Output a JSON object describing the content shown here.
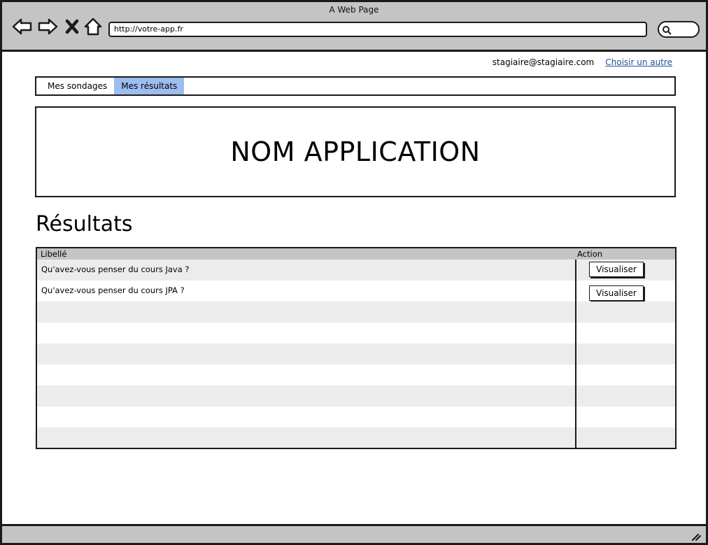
{
  "browser": {
    "window_title": "A Web Page",
    "url": "http://votre-app.fr"
  },
  "user": {
    "email": "stagiaire@stagiaire.com",
    "switch_link": "Choisir un autre"
  },
  "tabs": [
    {
      "label": "Mes sondages",
      "active": false
    },
    {
      "label": "Mes résultats",
      "active": true
    }
  ],
  "banner": {
    "title": "NOM APPLICATION"
  },
  "section": {
    "title": "Résultats"
  },
  "table": {
    "headers": {
      "label": "Libellé",
      "action": "Action"
    },
    "rows": [
      {
        "label": "Qu'avez-vous penser du cours Java ?",
        "action": "Visualiser"
      },
      {
        "label": "Qu'avez-vous penser du cours JPA ?",
        "action": "Visualiser"
      }
    ]
  },
  "colors": {
    "chrome": "#c4c4c4",
    "active_tab": "#9dbdf0",
    "link": "#1f4f9a",
    "row_alt": "#ececec"
  },
  "icons": [
    "back-arrow-icon",
    "forward-arrow-icon",
    "close-icon",
    "home-icon",
    "search-icon",
    "resize-grip-icon"
  ]
}
